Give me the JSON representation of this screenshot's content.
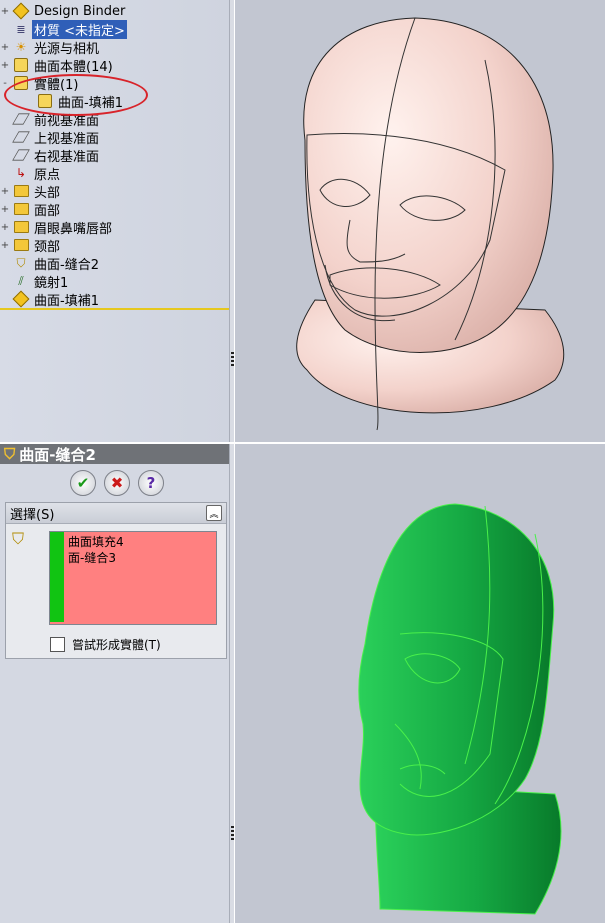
{
  "tree": {
    "items": [
      {
        "expander": "+",
        "icon": "design-binder-icon",
        "label": "Design Binder"
      },
      {
        "expander": "",
        "icon": "material-icon",
        "label": "材質 <未指定>",
        "selected": true
      },
      {
        "expander": "+",
        "icon": "lights-cameras-icon",
        "label": "光源与相机"
      },
      {
        "expander": "+",
        "icon": "surface-bodies-icon",
        "label": "曲面本體(14)"
      },
      {
        "expander": "-",
        "icon": "solid-bodies-icon",
        "label": "實體(1)"
      },
      {
        "expander": "",
        "icon": "solid-body-item-icon",
        "label": "曲面-填補1"
      },
      {
        "expander": "",
        "icon": "plane-icon",
        "label": "前视基准面"
      },
      {
        "expander": "",
        "icon": "plane-icon",
        "label": "上视基准面"
      },
      {
        "expander": "",
        "icon": "plane-icon",
        "label": "右视基准面"
      },
      {
        "expander": "",
        "icon": "origin-icon",
        "label": "原点"
      },
      {
        "expander": "+",
        "icon": "folder-icon",
        "label": "头部"
      },
      {
        "expander": "+",
        "icon": "folder-icon",
        "label": "面部"
      },
      {
        "expander": "+",
        "icon": "folder-icon",
        "label": "眉眼鼻嘴唇部"
      },
      {
        "expander": "+",
        "icon": "folder-icon",
        "label": "颈部"
      },
      {
        "expander": "",
        "icon": "knit-surface-icon",
        "label": "曲面-缝合2"
      },
      {
        "expander": "",
        "icon": "mirror-icon",
        "label": "鏡射1"
      },
      {
        "expander": "",
        "icon": "fill-surface-icon",
        "label": "曲面-填補1"
      }
    ]
  },
  "property_manager": {
    "title": "曲面-缝合2",
    "ok_label": "✔",
    "cancel_label": "✖",
    "help_label": "?",
    "group_title": "選擇(S)",
    "selection_items": [
      "曲面填充4",
      "面-缝合3"
    ],
    "checkbox_label": "嘗試形成實體(T)"
  },
  "colors": {
    "highlight": "#2f5fb8",
    "selection_box": "#ff8080",
    "selection_bar": "#11c412",
    "model_top": "#f6d8d2",
    "model_bottom": "#18b44a",
    "annotation": "#d8232a"
  }
}
